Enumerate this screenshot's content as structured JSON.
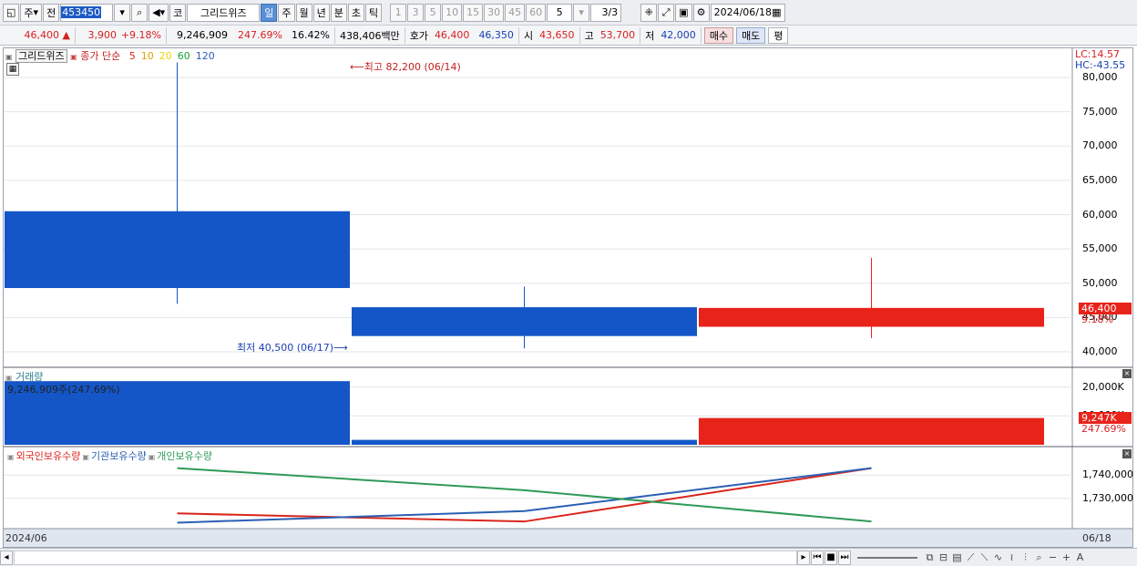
{
  "toolbar": {
    "market_label": "주",
    "prev_label": "전",
    "code": "453450",
    "code_label": "코",
    "stock_name": "그리드위즈",
    "periods": [
      "일",
      "주",
      "월",
      "년",
      "분",
      "초",
      "틱"
    ],
    "selected_period": "일",
    "intervals": [
      "1",
      "3",
      "5",
      "10",
      "15",
      "30",
      "45",
      "60"
    ],
    "count_value": "5",
    "page_value": "3/3",
    "date": "2024/06/18"
  },
  "quote": {
    "price": "46,400",
    "change": "3,900",
    "change_pct": "+9.18%",
    "volume": "9,246,909",
    "volume_ratio": "247.69%",
    "turnover": "16.42%",
    "amount": "438,406백만",
    "bid_label": "호가",
    "ask": "46,400",
    "bid": "46,350",
    "open_label": "시",
    "open": "43,650",
    "high_label": "고",
    "high": "53,700",
    "low_label": "저",
    "low": "42,000",
    "buy_label": "매수",
    "sell_label": "매도",
    "eval_label": "평"
  },
  "price_pane": {
    "stock_tag": "그리드위즈",
    "ma_label": "종가 단순",
    "ma_periods": [
      {
        "label": "5",
        "color": "#d9261c"
      },
      {
        "label": "10",
        "color": "#e0a000"
      },
      {
        "label": "20",
        "color": "#e8d800"
      },
      {
        "label": "60",
        "color": "#17a33b"
      },
      {
        "label": "120",
        "color": "#2b5fb3"
      }
    ],
    "high_annotation": "최고 82,200 (06/14)",
    "low_annotation": "최저 40,500 (06/17)",
    "lc": "LC:14.57",
    "hc": "HC:-43.55",
    "ticks": [
      "80,000",
      "75,000",
      "70,000",
      "65,000",
      "60,000",
      "55,000",
      "50,000",
      "45,000",
      "40,000"
    ],
    "current_price_tag": "46,400",
    "current_pct_tag": "9.18%"
  },
  "volume_pane": {
    "title": "거래량",
    "readout": "9,246,909주(247.69%)",
    "ticks": [
      "20,000K",
      "10,000K"
    ],
    "current_tag": "9,247K",
    "current_pct": "247.69%"
  },
  "holding_pane": {
    "series_labels": [
      {
        "label": "외국인보유수량",
        "color": "#d9261c"
      },
      {
        "label": "기관보유수량",
        "color": "#2b5fb3"
      },
      {
        "label": "개인보유수량",
        "color": "#2f9a57"
      }
    ],
    "ticks": [
      "1,740,000",
      "1,730,000"
    ]
  },
  "xaxis": {
    "left_label": "2024/06",
    "right_label": "06/18"
  },
  "chart_data": [
    {
      "type": "candlestick",
      "dates": [
        "06/14",
        "06/17",
        "06/18"
      ],
      "open": [
        60500,
        46500,
        43650
      ],
      "high": [
        82200,
        49500,
        53700
      ],
      "low": [
        47000,
        40500,
        42000
      ],
      "close": [
        49300,
        42300,
        46400
      ],
      "ylim": [
        38000,
        83000
      ],
      "colors": {
        "up": "#e8231a",
        "down": "#1456c8"
      }
    },
    {
      "type": "bar",
      "name": "거래량",
      "categories": [
        "06/14",
        "06/17",
        "06/18"
      ],
      "values": [
        22000000,
        1700000,
        9246909
      ],
      "ylim": [
        0,
        23000000
      ]
    },
    {
      "type": "line",
      "x": [
        "06/14",
        "06/17",
        "06/18"
      ],
      "series": [
        {
          "name": "외국인보유수량",
          "values": [
            1723500,
            1720000,
            1743000
          ],
          "color": "#d9261c"
        },
        {
          "name": "기관보유수량",
          "values": [
            1719500,
            1724500,
            1743000
          ],
          "color": "#2b5fb3"
        },
        {
          "name": "개인보유수량",
          "values": [
            1743000,
            1733500,
            1720000
          ],
          "color": "#2f9a57"
        }
      ],
      "ylim": [
        1718500,
        1746000
      ]
    }
  ]
}
